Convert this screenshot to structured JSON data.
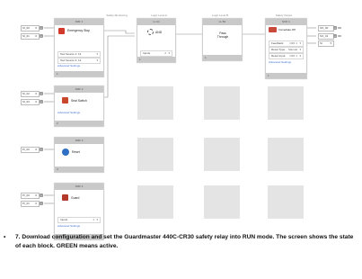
{
  "columns": [
    {
      "header": "Safety Monitoring"
    },
    {
      "header": "Logic Level A"
    },
    {
      "header": "Logic Level B"
    },
    {
      "header": "Safety Output"
    }
  ],
  "inputs": [
    {
      "label": "SI_00",
      "value": "0"
    },
    {
      "label": "SI_01",
      "value": "0"
    },
    {
      "label": "SI_02",
      "value": "0"
    },
    {
      "label": "SI_03",
      "value": "0"
    },
    {
      "label": "PI_00",
      "value": "0"
    },
    {
      "label": "PI_00",
      "value": "0"
    },
    {
      "label": "PI_01",
      "value": "0"
    }
  ],
  "blocks": {
    "emergency": {
      "id": "SMF 1",
      "name": "Emergency Stop",
      "rows": [
        {
          "label": "Test Source 1: 12",
          "value": ""
        },
        {
          "label": "Test Source 2: 12",
          "value": ""
        }
      ],
      "advanced": "Advanced Settings",
      "footer": "1"
    },
    "seal": {
      "id": "SMF 2",
      "name": "Seal Switch",
      "advanced": "Advanced Settings",
      "footer": "2"
    },
    "reset": {
      "id": "SMF 3",
      "name": "Reset",
      "footer": "3"
    },
    "guard": {
      "id": "SMF 4",
      "name": "Guard",
      "rows": [
        {
          "label": "Inputs",
          "value": "1"
        }
      ],
      "advanced": "Advanced Settings",
      "footer": "4"
    },
    "and": {
      "id": "LL A1",
      "name": "AND",
      "rows": [
        {
          "label": "Inputs",
          "value": "2"
        }
      ],
      "footer": "1"
    },
    "passthrough": {
      "id": "LL B1",
      "name": "Pass Through",
      "footer": "1"
    },
    "output": {
      "id": "SOF 1",
      "name": "Immediate Off",
      "rows": [
        {
          "label": "Feedback:",
          "value": "OFF 1"
        },
        {
          "label": "Reset Type:",
          "value": "Manual"
        },
        {
          "label": "Reset Input:",
          "value": "OFF 1"
        }
      ],
      "advanced": "Advanced Settings",
      "footer": "1"
    }
  },
  "outputs": [
    {
      "label": "SO_00",
      "value": "OF"
    },
    {
      "label": "SO_01",
      "value": "OF"
    },
    {
      "label": "SI",
      "value": ""
    }
  ],
  "caption": {
    "bullet": "•",
    "text": "7. Download configuration and set the Guardmaster 440C-CR30 safety relay into RUN mode. The screen shows the state of each block. GREEN means active."
  },
  "colors": {
    "emergency": "#d23a2c",
    "seal": "#c8462c",
    "reset": "#2f6fc4",
    "guard": "#b33a2a",
    "output": "#c94a3a",
    "link": "#3a6fd0"
  }
}
